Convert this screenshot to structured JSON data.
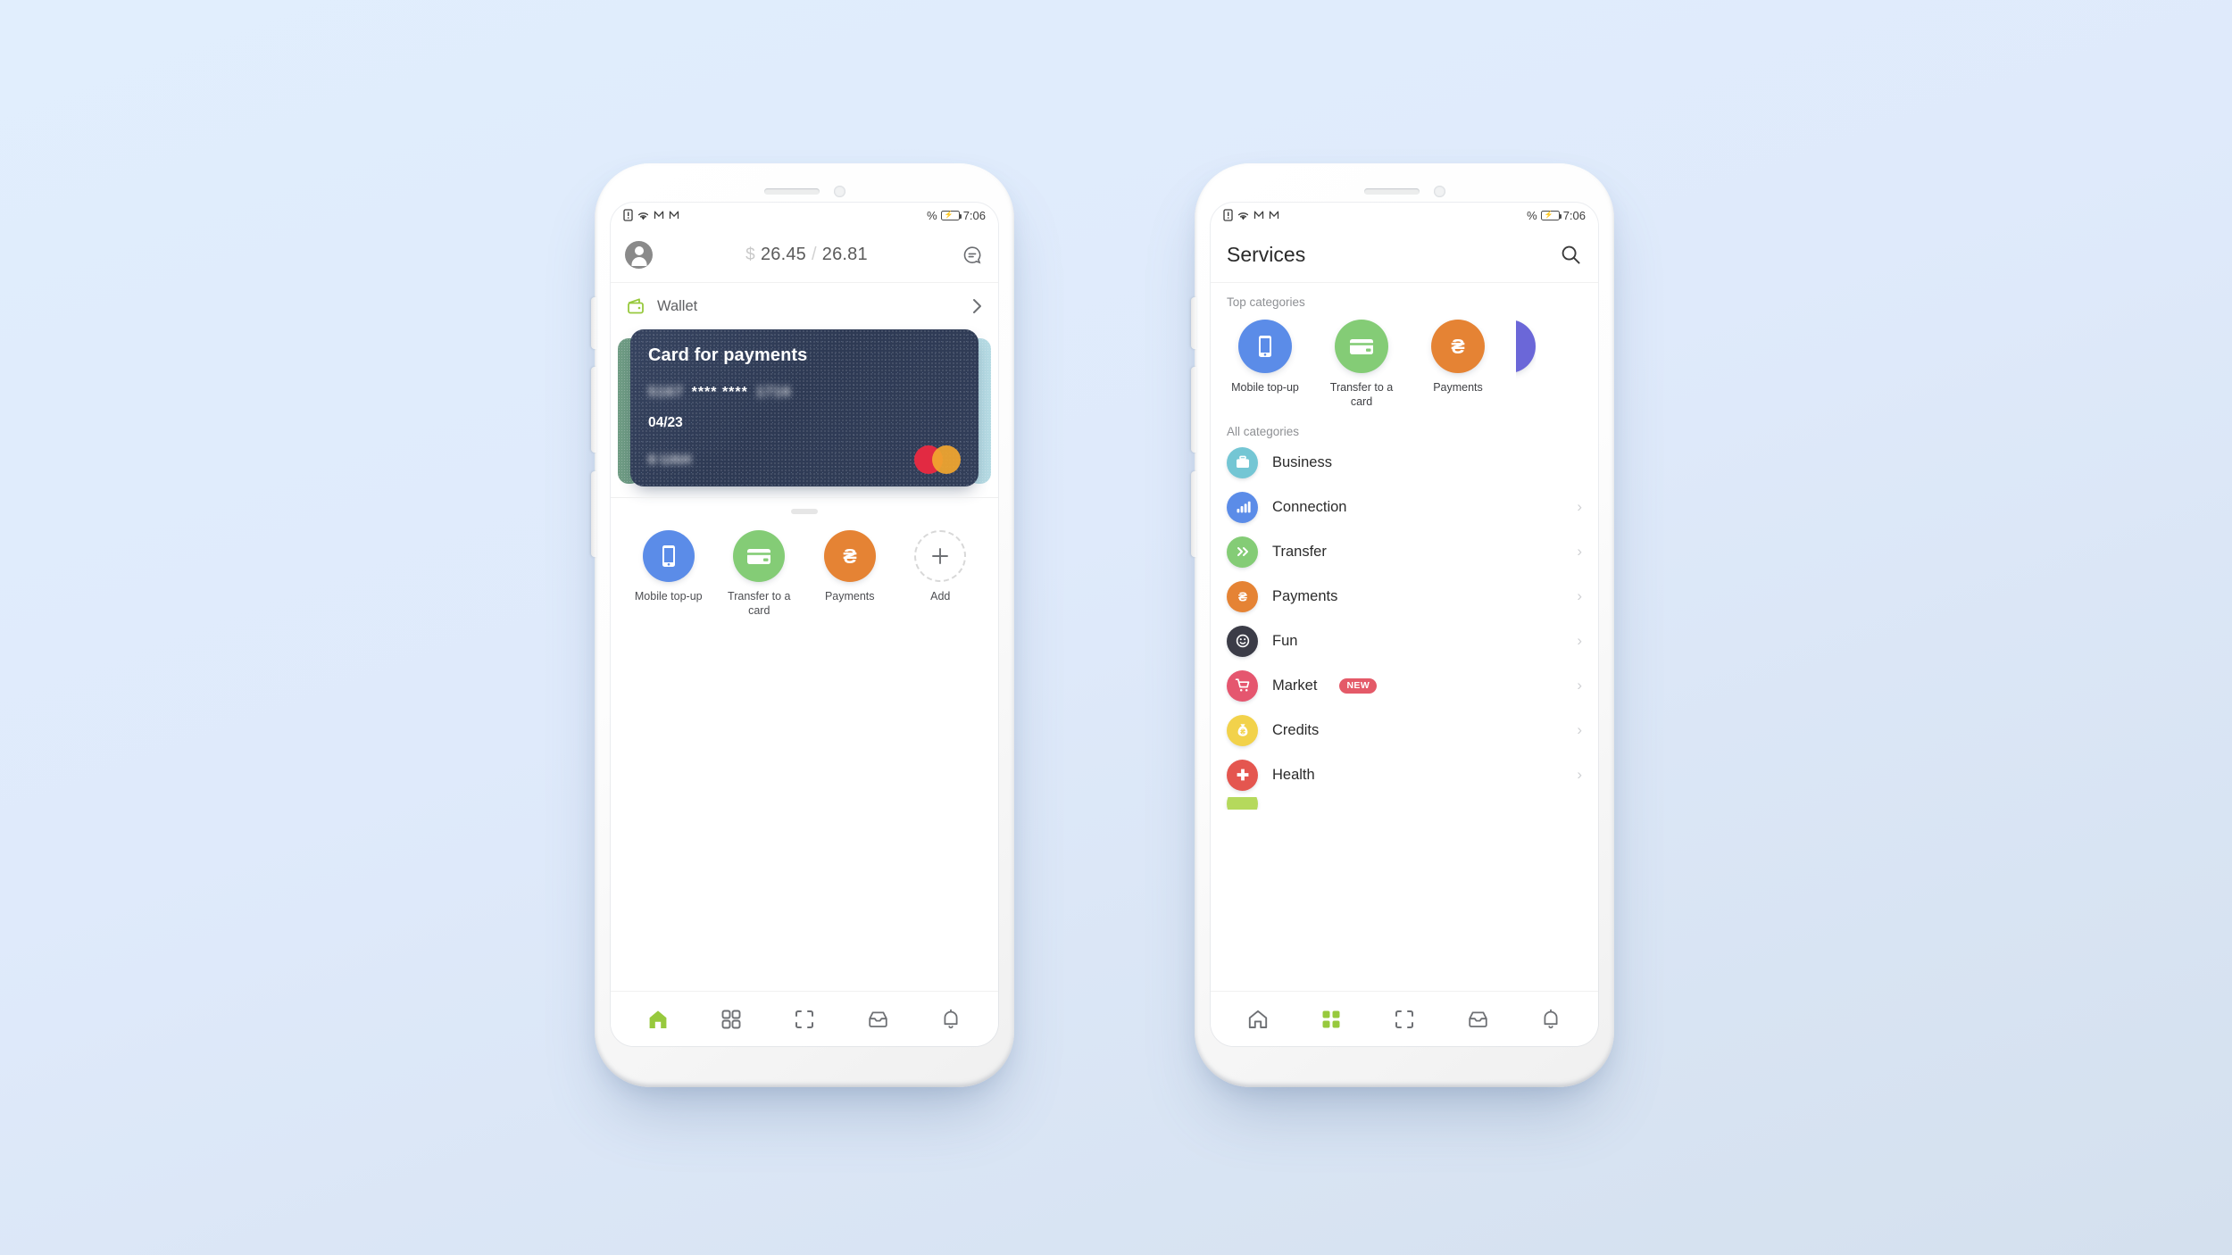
{
  "background": {
    "color_top": "#e1eefd",
    "color_bottom": "#d4e0ee"
  },
  "status_bar": {
    "time": "7:06",
    "percent_symbol": "%",
    "icons": [
      "sim-alert-icon",
      "wifi-icon",
      "mobile-data-m-icon",
      "mobile-data-m-icon",
      "battery-charging-icon"
    ]
  },
  "left_phone": {
    "header": {
      "avatar": "user-avatar",
      "currency_symbol": "$",
      "rate_buy": "26.45",
      "rate_separator": "/",
      "rate_sell": "26.81",
      "chat_icon": "chat-search-icon"
    },
    "wallet": {
      "label": "Wallet",
      "icon": "wallet-icon",
      "chevron": "›",
      "accent": "#97c93d"
    },
    "card": {
      "title": "Card for payments",
      "number_prefix": "5167",
      "number_mask": "**** ****",
      "number_suffix": "1716",
      "expiry": "04/23",
      "balance": "6 UAH",
      "brand": "mastercard",
      "bg_color": "#323e59",
      "peek_left_color": "#6f9c84",
      "peek_right_color": "#b6dbe4"
    },
    "quick_actions": [
      {
        "label": "Mobile top-up",
        "icon": "phone-icon",
        "color": "#5b8ce8"
      },
      {
        "label": "Transfer to a card",
        "icon": "credit-card-icon",
        "color": "#84cc76"
      },
      {
        "label": "Payments",
        "icon": "hryvnia-icon",
        "color": "#e58334"
      },
      {
        "label": "Add",
        "icon": "plus-icon",
        "color": "#d8d8d8"
      }
    ],
    "bottom_nav": [
      {
        "name": "home",
        "icon": "home-icon",
        "active": true
      },
      {
        "name": "services",
        "icon": "grid-icon",
        "active": false
      },
      {
        "name": "scan",
        "icon": "scan-icon",
        "active": false
      },
      {
        "name": "inbox",
        "icon": "inbox-icon",
        "active": false
      },
      {
        "name": "notifications",
        "icon": "bell-icon",
        "active": false
      }
    ],
    "active_color": "#97c93d"
  },
  "right_phone": {
    "header": {
      "title": "Services",
      "search_icon": "search-icon"
    },
    "top_categories_label": "Top categories",
    "top_categories": [
      {
        "label": "Mobile top-up",
        "icon": "phone-icon",
        "color": "#5b8ce8"
      },
      {
        "label": "Transfer to a card",
        "icon": "credit-card-icon",
        "color": "#84cc76"
      },
      {
        "label": "Payments",
        "icon": "hryvnia-icon",
        "color": "#e58334"
      },
      {
        "label": "",
        "icon": "purple-category-icon",
        "color": "#6b67d8"
      }
    ],
    "all_categories_label": "All categories",
    "categories": [
      {
        "label": "Business",
        "icon": "briefcase-icon",
        "color": "#74c6d4",
        "badge": "",
        "chevron": ""
      },
      {
        "label": "Connection",
        "icon": "signal-bars-icon",
        "color": "#5b8ce8",
        "badge": "",
        "chevron": "›"
      },
      {
        "label": "Transfer",
        "icon": "double-chevron-icon",
        "color": "#84cc76",
        "badge": "",
        "chevron": "›"
      },
      {
        "label": "Payments",
        "icon": "hryvnia-icon",
        "color": "#e58334",
        "badge": "",
        "chevron": "›"
      },
      {
        "label": "Fun",
        "icon": "smiley-icon",
        "color": "#3b3c४7",
        "badge": "",
        "chevron": "›"
      },
      {
        "label": "Market",
        "icon": "shopping-cart-icon",
        "color": "#e5566f",
        "badge": "NEW",
        "chevron": "›"
      },
      {
        "label": "Credits",
        "icon": "money-bag-icon",
        "color": "#f2d24b",
        "badge": "",
        "chevron": "›"
      },
      {
        "label": "Health",
        "icon": "medical-cross-icon",
        "color": "#e4564f",
        "badge": "",
        "chevron": "›"
      }
    ],
    "bottom_nav": [
      {
        "name": "home",
        "icon": "home-icon",
        "active": false
      },
      {
        "name": "services",
        "icon": "grid-icon",
        "active": true
      },
      {
        "name": "scan",
        "icon": "scan-icon",
        "active": false
      },
      {
        "name": "inbox",
        "icon": "inbox-icon",
        "active": false
      },
      {
        "name": "notifications",
        "icon": "bell-icon",
        "active": false
      }
    ],
    "active_color": "#97c93d"
  }
}
